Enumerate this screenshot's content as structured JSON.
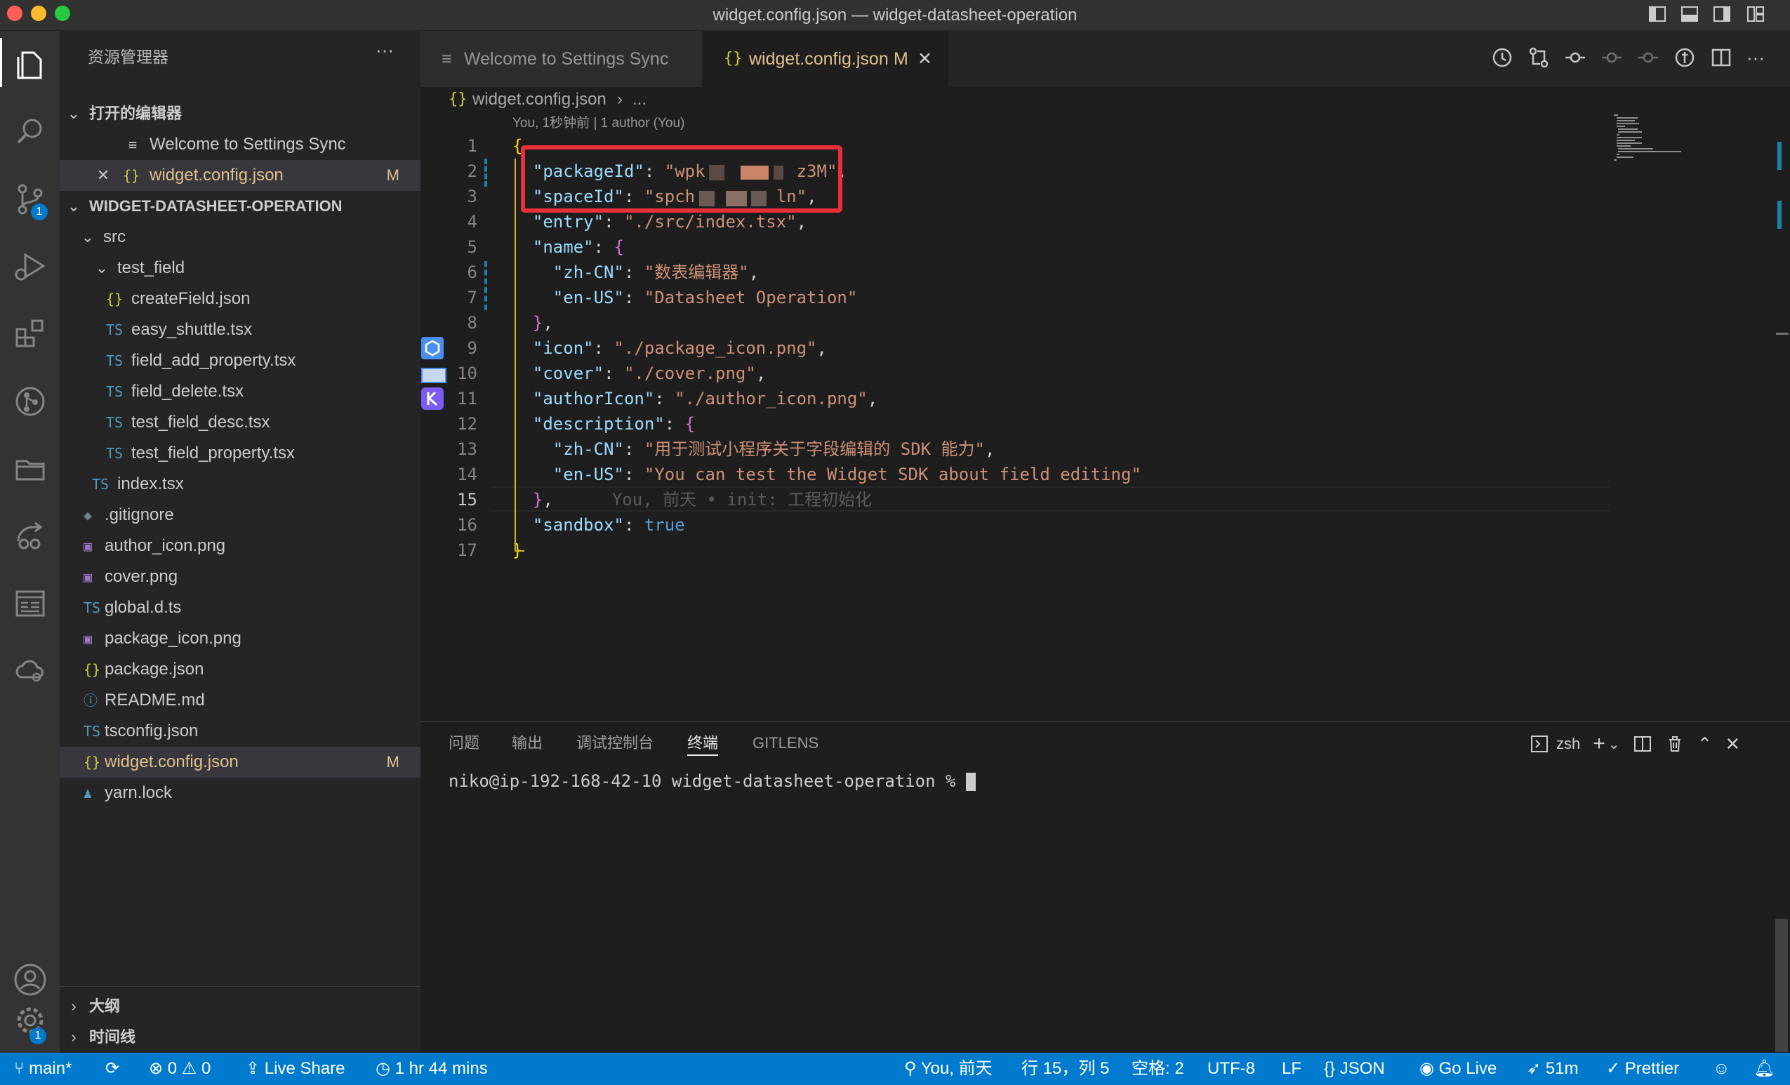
{
  "window": {
    "title": "widget.config.json — widget-datasheet-operation"
  },
  "activity_bar": {
    "items": [
      {
        "name": "explorer-icon"
      },
      {
        "name": "search-icon"
      },
      {
        "name": "source-control-icon",
        "badge": "1"
      },
      {
        "name": "run-debug-icon"
      },
      {
        "name": "extensions-icon"
      },
      {
        "name": "git-graph-icon"
      },
      {
        "name": "folder-icon"
      },
      {
        "name": "remote-icon"
      },
      {
        "name": "board-icon"
      },
      {
        "name": "cloud-icon"
      }
    ],
    "account_badge": "",
    "settings_badge": "1"
  },
  "sidebar": {
    "title": "资源管理器",
    "more": "···",
    "open_editors_label": "打开的编辑器",
    "open_editors": [
      {
        "name": "Welcome to Settings Sync",
        "icon": "≡",
        "flag": ""
      },
      {
        "name": "widget.config.json",
        "icon": "{}",
        "flag": "M"
      }
    ],
    "project_label": "WIDGET-DATASHEET-OPERATION",
    "tree": [
      {
        "name": "src",
        "icon": "",
        "indent": 1,
        "chev": "open"
      },
      {
        "name": "test_field",
        "icon": "",
        "indent": 2,
        "chev": "open"
      },
      {
        "name": "createField.json",
        "icon": "{}",
        "indent": 3
      },
      {
        "name": "easy_shuttle.tsx",
        "icon": "TS",
        "indent": 3
      },
      {
        "name": "field_add_property.tsx",
        "icon": "TS",
        "indent": 3
      },
      {
        "name": "field_delete.tsx",
        "icon": "TS",
        "indent": 3
      },
      {
        "name": "test_field_desc.tsx",
        "icon": "TS",
        "indent": 3
      },
      {
        "name": "test_field_property.tsx",
        "icon": "TS",
        "indent": 3
      },
      {
        "name": "index.tsx",
        "icon": "TS",
        "indent": 2
      },
      {
        "name": ".gitignore",
        "icon": "◆",
        "indent": 1
      },
      {
        "name": "author_icon.png",
        "icon": "▣",
        "indent": 1
      },
      {
        "name": "cover.png",
        "icon": "▣",
        "indent": 1
      },
      {
        "name": "global.d.ts",
        "icon": "TS",
        "indent": 1
      },
      {
        "name": "package_icon.png",
        "icon": "▣",
        "indent": 1
      },
      {
        "name": "package.json",
        "icon": "{}",
        "indent": 1
      },
      {
        "name": "README.md",
        "icon": "ⓘ",
        "indent": 1
      },
      {
        "name": "tsconfig.json",
        "icon": "TS",
        "indent": 1
      },
      {
        "name": "widget.config.json",
        "icon": "{}",
        "indent": 1,
        "flag": "M"
      },
      {
        "name": "yarn.lock",
        "icon": "♟",
        "indent": 1
      }
    ],
    "outline_label": "大纲",
    "timeline_label": "时间线"
  },
  "tabs": [
    {
      "label": "Welcome to Settings Sync",
      "icon": "≡",
      "active": false
    },
    {
      "label": "widget.config.json",
      "icon": "{}",
      "flag": "M",
      "active": true
    }
  ],
  "breadcrumb": {
    "file": "widget.config.json",
    "more": "..."
  },
  "codelens": "You, 1秒钟前 | 1 author (You)",
  "editor": {
    "line_numbers": [
      "1",
      "2",
      "3",
      "4",
      "5",
      "6",
      "7",
      "8",
      "9",
      "10",
      "11",
      "12",
      "13",
      "14",
      "15",
      "16",
      "17"
    ],
    "current_line": "15",
    "blame_annotation": "You, 前天 • init: 工程初始化",
    "lines": [
      {
        "tokens": [
          [
            "b1",
            "{"
          ]
        ]
      },
      {
        "tokens": [
          [
            "p",
            "  "
          ],
          [
            "k",
            "\"packageId\""
          ],
          [
            "p",
            ": "
          ],
          [
            "s",
            "\"wpk"
          ],
          [
            "p",
            "         "
          ],
          [
            "s",
            "z3M\""
          ],
          [
            "p",
            ","
          ]
        ]
      },
      {
        "tokens": [
          [
            "p",
            "  "
          ],
          [
            "k",
            "\"spaceId\""
          ],
          [
            "p",
            ": "
          ],
          [
            "s",
            "\"spch"
          ],
          [
            "p",
            "        "
          ],
          [
            "s",
            "ln\""
          ],
          [
            "p",
            ","
          ]
        ]
      },
      {
        "tokens": [
          [
            "p",
            "  "
          ],
          [
            "k",
            "\"entry\""
          ],
          [
            "p",
            ": "
          ],
          [
            "s",
            "\"./src/index.tsx\""
          ],
          [
            "p",
            ","
          ]
        ]
      },
      {
        "tokens": [
          [
            "p",
            "  "
          ],
          [
            "k",
            "\"name\""
          ],
          [
            "p",
            ": "
          ],
          [
            "b2",
            "{"
          ]
        ]
      },
      {
        "tokens": [
          [
            "p",
            "    "
          ],
          [
            "k",
            "\"zh-CN\""
          ],
          [
            "p",
            ": "
          ],
          [
            "s",
            "\"数表编辑器\""
          ],
          [
            "p",
            ","
          ]
        ]
      },
      {
        "tokens": [
          [
            "p",
            "    "
          ],
          [
            "k",
            "\"en-US\""
          ],
          [
            "p",
            ": "
          ],
          [
            "s",
            "\"Datasheet Operation\""
          ]
        ]
      },
      {
        "tokens": [
          [
            "p",
            "  "
          ],
          [
            "b2",
            "}"
          ],
          [
            "p",
            ","
          ]
        ]
      },
      {
        "tokens": [
          [
            "p",
            "  "
          ],
          [
            "k",
            "\"icon\""
          ],
          [
            "p",
            ": "
          ],
          [
            "s",
            "\"./package_icon.png\""
          ],
          [
            "p",
            ","
          ]
        ]
      },
      {
        "tokens": [
          [
            "p",
            "  "
          ],
          [
            "k",
            "\"cover\""
          ],
          [
            "p",
            ": "
          ],
          [
            "s",
            "\"./cover.png\""
          ],
          [
            "p",
            ","
          ]
        ]
      },
      {
        "tokens": [
          [
            "p",
            "  "
          ],
          [
            "k",
            "\"authorIcon\""
          ],
          [
            "p",
            ": "
          ],
          [
            "s",
            "\"./author_icon.png\""
          ],
          [
            "p",
            ","
          ]
        ]
      },
      {
        "tokens": [
          [
            "p",
            "  "
          ],
          [
            "k",
            "\"description\""
          ],
          [
            "p",
            ": "
          ],
          [
            "b2",
            "{"
          ]
        ]
      },
      {
        "tokens": [
          [
            "p",
            "    "
          ],
          [
            "k",
            "\"zh-CN\""
          ],
          [
            "p",
            ": "
          ],
          [
            "s",
            "\"用于测试小程序关于字段编辑的 SDK 能力\""
          ],
          [
            "p",
            ","
          ]
        ]
      },
      {
        "tokens": [
          [
            "p",
            "    "
          ],
          [
            "k",
            "\"en-US\""
          ],
          [
            "p",
            ": "
          ],
          [
            "s",
            "\"You can test the Widget SDK about field editing\""
          ]
        ]
      },
      {
        "tokens": [
          [
            "p",
            "  "
          ],
          [
            "b2",
            "}"
          ],
          [
            "p",
            ","
          ]
        ]
      },
      {
        "tokens": [
          [
            "p",
            "  "
          ],
          [
            "k",
            "\"sandbox\""
          ],
          [
            "p",
            ": "
          ],
          [
            "bool",
            "true"
          ]
        ]
      },
      {
        "tokens": [
          [
            "b1",
            "}"
          ]
        ]
      }
    ]
  },
  "panel": {
    "tabs": [
      "问题",
      "输出",
      "调试控制台",
      "终端",
      "GITLENS"
    ],
    "active_tab": "终端",
    "shell": "zsh",
    "prompt": "niko@ip-192-168-42-10 widget-datasheet-operation % "
  },
  "statusbar": {
    "branch": "main*",
    "errors": "0",
    "warnings": "0",
    "live_share": "Live Share",
    "time": "1 hr 44 mins",
    "blame": "You, 前天",
    "position": "行 15，列 5",
    "indent": "空格: 2",
    "encoding": "UTF-8",
    "eol": "LF",
    "language": "JSON",
    "go_live": "Go Live",
    "deploy_time": "51m",
    "prettier": "Prettier"
  },
  "colors": {
    "accent": "#007acc",
    "annotation_box": "#e8303b",
    "modified": "#e2c08d"
  }
}
